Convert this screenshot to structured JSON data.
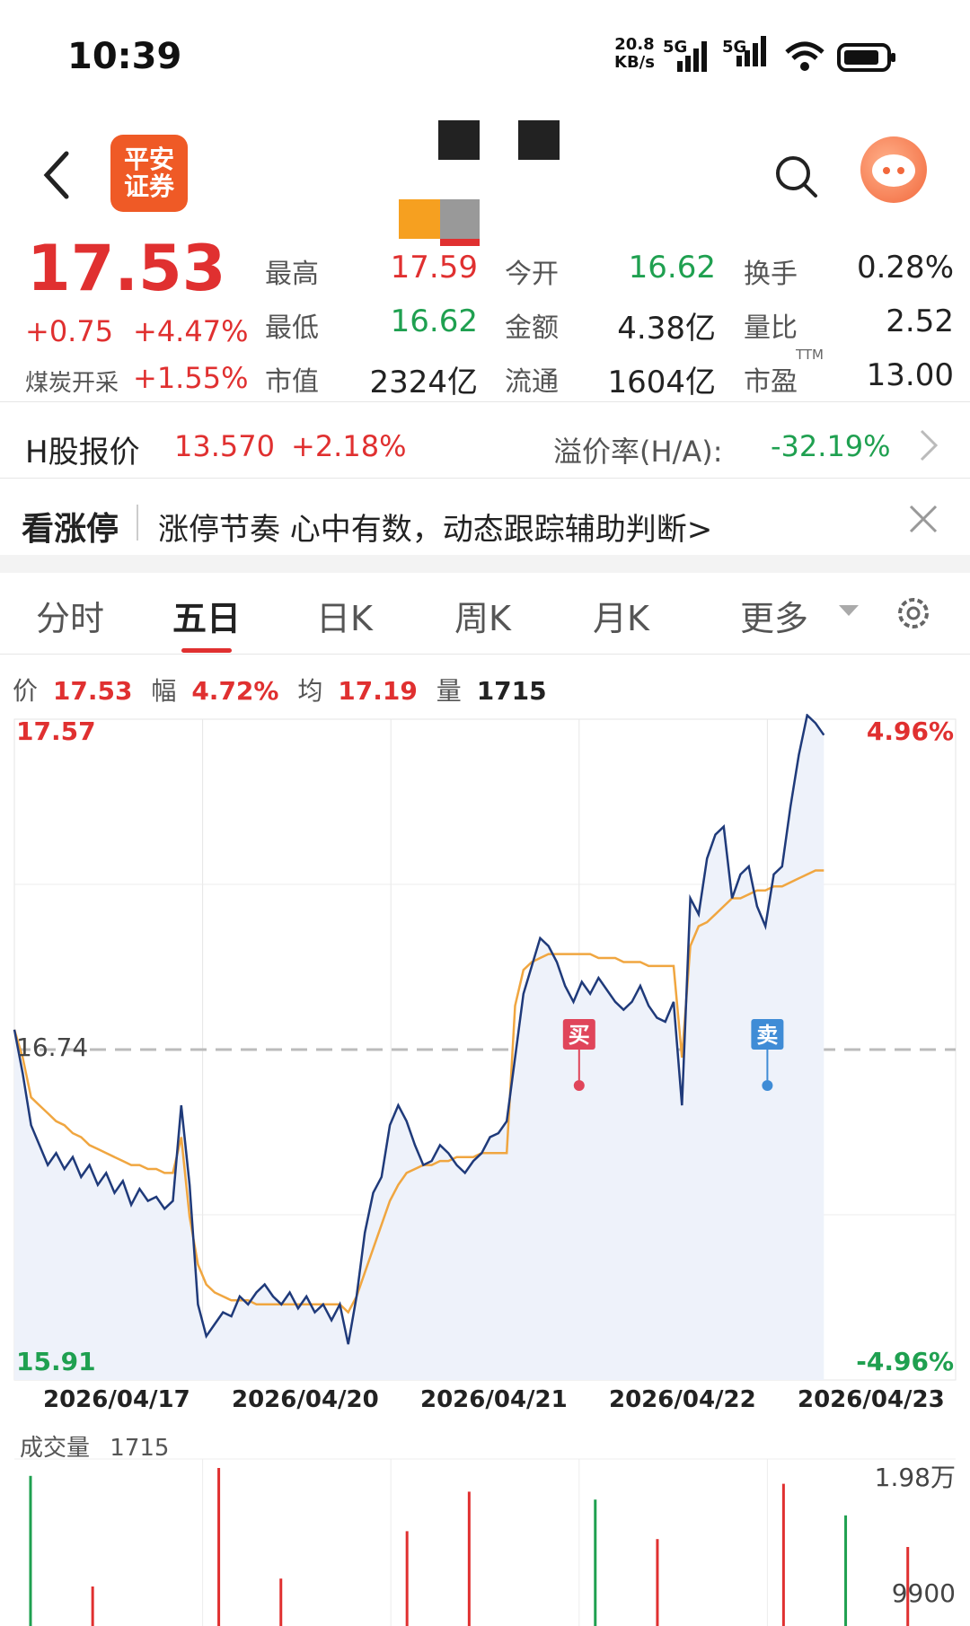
{
  "status": {
    "time": "10:39",
    "speed_value": "20.8",
    "speed_unit": "KB/s",
    "net1": "5G",
    "net2": "5G"
  },
  "header": {
    "logo_line1": "平安",
    "logo_line2": "证券"
  },
  "quote": {
    "price": "17.53",
    "change": "+0.75",
    "change_pct": "+4.47%",
    "sector_name": "煤炭开采",
    "sector_pct": "+1.55%",
    "rows": [
      [
        {
          "label": "最高",
          "value": "17.59",
          "color": "#e03030"
        },
        {
          "label": "今开",
          "value": "16.62",
          "color": "#1fa050"
        },
        {
          "label": "换手",
          "value": "0.28%",
          "color": "#222222"
        }
      ],
      [
        {
          "label": "最低",
          "value": "16.62",
          "color": "#1fa050"
        },
        {
          "label": "金额",
          "value": "4.38亿",
          "color": "#222222"
        },
        {
          "label": "量比",
          "value": "2.52",
          "color": "#222222"
        }
      ],
      [
        {
          "label": "市值",
          "value": "2324亿",
          "color": "#222222"
        },
        {
          "label": "流通",
          "value": "1604亿",
          "color": "#222222"
        },
        {
          "label": "市盈",
          "value": "13.00",
          "color": "#222222",
          "sup": "TTM"
        }
      ]
    ]
  },
  "hshare": {
    "label": "H股报价",
    "price": "13.570",
    "pct": "+2.18%",
    "premium_label": "溢价率(H/A):",
    "premium_value": "-32.19%"
  },
  "banner": {
    "title": "看涨停",
    "text": "涨停节奏 心中有数，动态跟踪辅助判断>"
  },
  "tabs": [
    {
      "label": "分时",
      "active": false
    },
    {
      "label": "五日",
      "active": true
    },
    {
      "label": "日K",
      "active": false
    },
    {
      "label": "周K",
      "active": false
    },
    {
      "label": "月K",
      "active": false
    },
    {
      "label": "更多",
      "active": false
    }
  ],
  "info_bar": {
    "price_label": "价",
    "price": "17.53",
    "amp_label": "幅",
    "amp": "4.72%",
    "avg_label": "均",
    "avg": "17.19",
    "vol_label": "量",
    "vol": "1715"
  },
  "chart_data": {
    "type": "line",
    "y_max_label": "17.57",
    "y_min_label": "15.91",
    "y_mid_label": "16.74",
    "pct_max_label": "4.96%",
    "pct_min_label": "-4.96%",
    "ylim": [
      15.91,
      17.57
    ],
    "days": [
      "2026/04/17",
      "2026/04/20",
      "2026/04/21",
      "2026/04/22",
      "2026/04/23"
    ],
    "markers": [
      {
        "label": "买",
        "color": "#e0455a"
      },
      {
        "label": "卖",
        "color": "#3f8cd6"
      }
    ],
    "series": [
      {
        "values": [
          16.79,
          16.68,
          16.55,
          16.5,
          16.45,
          16.48,
          16.44,
          16.47,
          16.42,
          16.45,
          16.4,
          16.43,
          16.38,
          16.41,
          16.35,
          16.39,
          16.36,
          16.37,
          16.34,
          16.36,
          16.6,
          16.4,
          16.1,
          16.02,
          16.05,
          16.08,
          16.07,
          16.12,
          16.1,
          16.13,
          16.15,
          16.12,
          16.1,
          16.13,
          16.09,
          16.12,
          16.08,
          16.1,
          16.06,
          16.1,
          16.0,
          16.12,
          16.28,
          16.38,
          16.42,
          16.55,
          16.6,
          16.56,
          16.5,
          16.45,
          16.46,
          16.5,
          16.48,
          16.45,
          16.43,
          16.46,
          16.48,
          16.52,
          16.53,
          16.56,
          16.72,
          16.88,
          16.95,
          17.02,
          17.0,
          16.96,
          16.9,
          16.86,
          16.91,
          16.88,
          16.92,
          16.89,
          16.86,
          16.84,
          16.86,
          16.9,
          16.85,
          16.82,
          16.81,
          16.86,
          16.6,
          17.12,
          17.08,
          17.22,
          17.28,
          17.3,
          17.12,
          17.18,
          17.2,
          17.1,
          17.05,
          17.18,
          17.2,
          17.35,
          17.48,
          17.58,
          17.56,
          17.53
        ]
      },
      {
        "values": [
          16.79,
          16.72,
          16.62,
          16.6,
          16.58,
          16.56,
          16.55,
          16.53,
          16.52,
          16.5,
          16.49,
          16.48,
          16.47,
          16.46,
          16.45,
          16.45,
          16.44,
          16.44,
          16.43,
          16.43,
          16.52,
          16.32,
          16.2,
          16.15,
          16.13,
          16.12,
          16.11,
          16.11,
          16.11,
          16.1,
          16.1,
          16.1,
          16.1,
          16.1,
          16.1,
          16.1,
          16.1,
          16.1,
          16.1,
          16.1,
          16.08,
          16.12,
          16.18,
          16.24,
          16.3,
          16.36,
          16.4,
          16.43,
          16.44,
          16.45,
          16.45,
          16.46,
          16.46,
          16.47,
          16.47,
          16.47,
          16.48,
          16.48,
          16.48,
          16.48,
          16.85,
          16.94,
          16.96,
          16.97,
          16.98,
          16.98,
          16.98,
          16.98,
          16.98,
          16.98,
          16.97,
          16.97,
          16.97,
          16.96,
          16.96,
          16.96,
          16.95,
          16.95,
          16.95,
          16.95,
          16.72,
          17.0,
          17.05,
          17.06,
          17.08,
          17.1,
          17.12,
          17.12,
          17.13,
          17.14,
          17.14,
          17.15,
          17.15,
          17.16,
          17.17,
          17.18,
          17.19,
          17.19
        ]
      }
    ],
    "volume": {
      "label": "成交量",
      "value": "1715",
      "max_label": "1.98万",
      "mid_label": "9900",
      "bars": [
        {
          "day": 0,
          "v": 0.95,
          "c": "#1fa050"
        },
        {
          "day": 0,
          "v": 0.25,
          "c": "#e03030"
        },
        {
          "day": 1,
          "v": 1.0,
          "c": "#e03030"
        },
        {
          "day": 1,
          "v": 0.3,
          "c": "#e03030"
        },
        {
          "day": 2,
          "v": 0.6,
          "c": "#e03030"
        },
        {
          "day": 2,
          "v": 0.85,
          "c": "#e03030"
        },
        {
          "day": 3,
          "v": 0.8,
          "c": "#1fa050"
        },
        {
          "day": 3,
          "v": 0.55,
          "c": "#e03030"
        },
        {
          "day": 4,
          "v": 0.9,
          "c": "#e03030"
        },
        {
          "day": 4,
          "v": 0.7,
          "c": "#1fa050"
        },
        {
          "day": 4,
          "v": 0.5,
          "c": "#e03030"
        }
      ]
    }
  }
}
